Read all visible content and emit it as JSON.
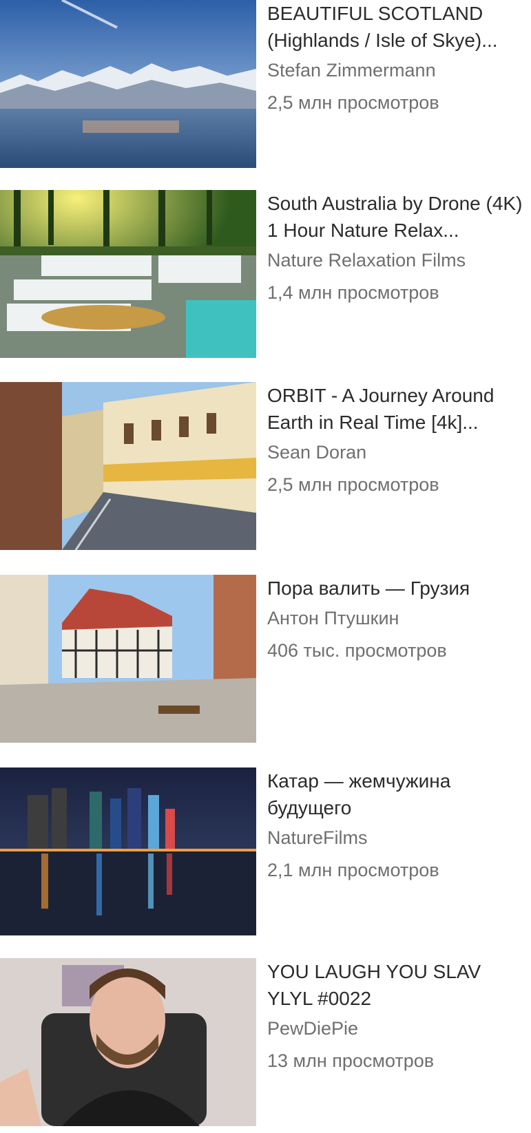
{
  "videos": [
    {
      "title": "BEAUTIFUL SCOTLAND (Highlands / Isle of Skye)...",
      "channel": "Stefan Zimmermann",
      "views": "2,5 млн просмотров",
      "thumb_icon": "mountain-lake-thumbnail"
    },
    {
      "title": "South Australia by Drone (4K) 1 Hour Nature Relax...",
      "channel": "Nature Relaxation Films",
      "views": "1,4 млн просмотров",
      "thumb_icon": "waterfall-thumbnail"
    },
    {
      "title": "ORBIT - A Journey Around Earth in Real Time [4k]...",
      "channel": "Sean Doran",
      "views": "2,5 млн просмотров",
      "thumb_icon": "old-town-street-thumbnail"
    },
    {
      "title": "Пора валить — Грузия",
      "channel": "Антон Птушкин",
      "views": "406 тыс. просмотров",
      "thumb_icon": "tudor-square-thumbnail"
    },
    {
      "title": "Катар — жемчужина будущего",
      "channel": "NatureFilms",
      "views": "2,1 млн просмотров",
      "thumb_icon": "night-skyline-thumbnail"
    },
    {
      "title": "YOU LAUGH YOU SLAV YLYL #0022",
      "channel": "PewDiePie",
      "views": "13 млн просмотров",
      "thumb_icon": "man-waving-thumbnail"
    }
  ]
}
